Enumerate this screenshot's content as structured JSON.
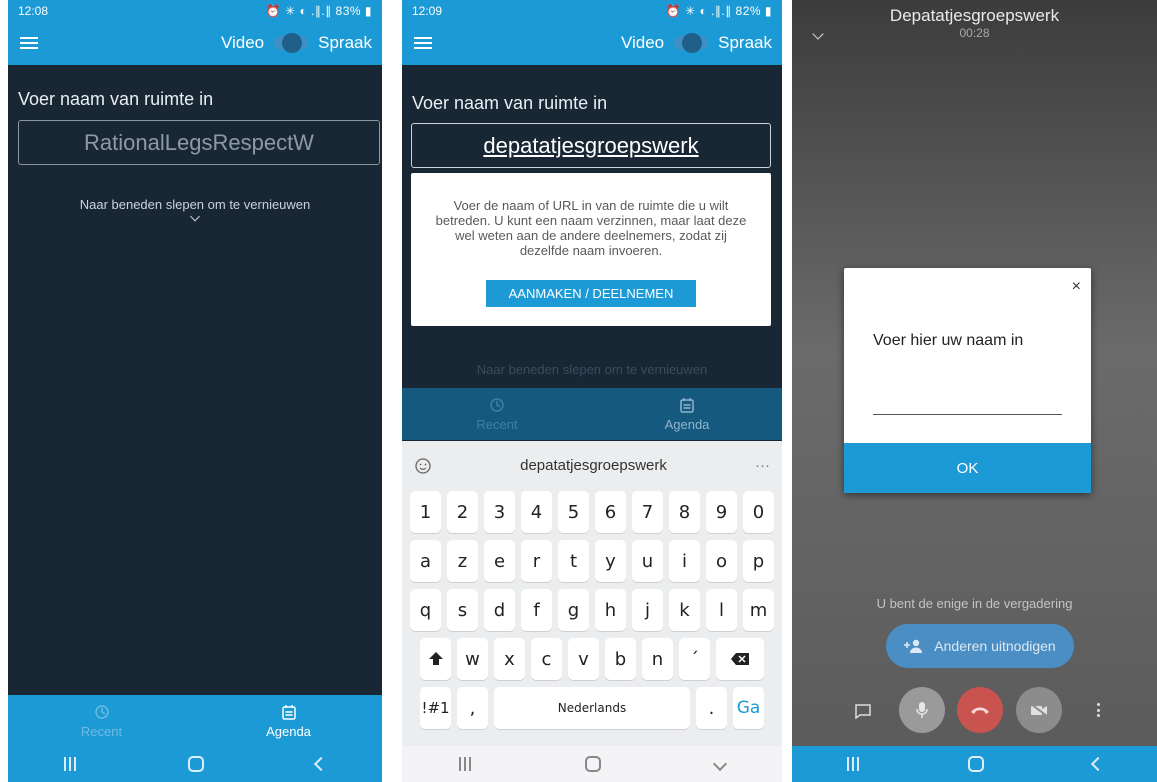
{
  "panel1": {
    "status": {
      "time": "12:08",
      "right": "⏰ ✳ ◐ .∥.∥ 83% ▮"
    },
    "appbar": {
      "video_label": "Video",
      "voice_label": "Spraak"
    },
    "room_label": "Voer naam van ruimte in",
    "room_input_placeholder": "RationalLegsRespectW",
    "refresh_hint": "Naar beneden slepen om te vernieuwen",
    "tabs": [
      {
        "label": "Recent",
        "icon": "history-icon"
      },
      {
        "label": "Agenda",
        "icon": "calendar-icon"
      }
    ]
  },
  "panel2": {
    "status": {
      "time": "12:09",
      "right": "⏰ ✳ ◐ .∥.∥ 82% ▮"
    },
    "appbar": {
      "video_label": "Video",
      "voice_label": "Spraak"
    },
    "room_label": "Voer naam van ruimte in",
    "room_input_value": "depatatjesgroepswerk",
    "info_text": "Voer de naam of URL in van de ruimte die u wilt betreden. U kunt een naam verzinnen, maar laat deze wel weten aan de andere deelnemers, zodat zij dezelfde naam invoeren.",
    "create_button": "AANMAKEN / DEELNEMEN",
    "refresh_hint": "Naar beneden slepen om te vernieuwen",
    "tabs": [
      {
        "label": "Recent",
        "icon": "history-icon"
      },
      {
        "label": "Agenda",
        "icon": "calendar-icon"
      }
    ],
    "keyboard": {
      "suggestion": "depatatjesgroepswerk",
      "more": "···",
      "row1": [
        "1",
        "2",
        "3",
        "4",
        "5",
        "6",
        "7",
        "8",
        "9",
        "0"
      ],
      "row2": [
        "a",
        "z",
        "e",
        "r",
        "t",
        "y",
        "u",
        "i",
        "o",
        "p"
      ],
      "row3": [
        "q",
        "s",
        "d",
        "f",
        "g",
        "h",
        "j",
        "k",
        "l",
        "m"
      ],
      "row4": [
        "w",
        "x",
        "c",
        "v",
        "b",
        "n",
        "´"
      ],
      "symbols": "!#1",
      "comma": ",",
      "space": "Nederlands",
      "period": ".",
      "go": "Ga"
    }
  },
  "panel3": {
    "title": "Depatatjesgroepswerk",
    "timer": "00:28",
    "dialog": {
      "close": "×",
      "prompt": "Voer hier uw naam in",
      "name_value": "",
      "ok": "OK"
    },
    "alone_text": "U bent de enige in de vergadering",
    "invite_button": "Anderen uitnodigen"
  },
  "colors": {
    "accent": "#1c9ad6",
    "dark_bg": "#192634",
    "hangup": "#d9534f"
  }
}
